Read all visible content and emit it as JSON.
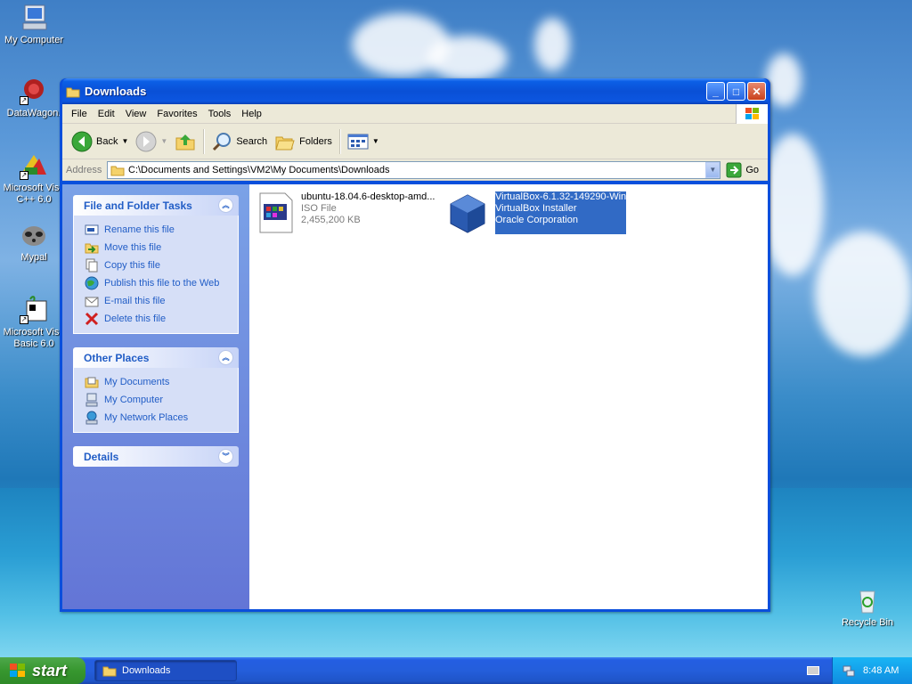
{
  "desktop": {
    "icons": [
      {
        "label": "My Computer"
      },
      {
        "label": "DataWagon."
      },
      {
        "label": "Microsoft Visu C++ 6.0"
      },
      {
        "label": "Mypal"
      },
      {
        "label": "Microsoft Visu Basic 6.0"
      },
      {
        "label": "Recycle Bin"
      }
    ]
  },
  "window": {
    "title": "Downloads",
    "menu": [
      "File",
      "Edit",
      "View",
      "Favorites",
      "Tools",
      "Help"
    ],
    "toolbar": {
      "back": "Back",
      "search": "Search",
      "folders": "Folders"
    },
    "address": {
      "label": "Address",
      "path": "C:\\Documents and Settings\\VM2\\My Documents\\Downloads",
      "go": "Go"
    }
  },
  "taskpane": {
    "file_tasks": {
      "title": "File and Folder Tasks",
      "items": [
        "Rename this file",
        "Move this file",
        "Copy this file",
        "Publish this file to the Web",
        "E-mail this file",
        "Delete this file"
      ]
    },
    "other_places": {
      "title": "Other Places",
      "items": [
        "My Documents",
        "My Computer",
        "My Network Places"
      ]
    },
    "details": {
      "title": "Details"
    }
  },
  "files": [
    {
      "name": "ubuntu-18.04.6-desktop-amd...",
      "type": "ISO File",
      "size": "2,455,200 KB",
      "selected": false
    },
    {
      "name": "VirtualBox-6.1.32-149290-Win",
      "type": "VirtualBox Installer",
      "size": "Oracle Corporation",
      "selected": true
    }
  ],
  "taskbar": {
    "start": "start",
    "task": "Downloads",
    "clock": "8:48 AM"
  },
  "colors": {
    "accent": "#0a4fdc",
    "task_link": "#215dc6",
    "selection": "#316ac5"
  }
}
